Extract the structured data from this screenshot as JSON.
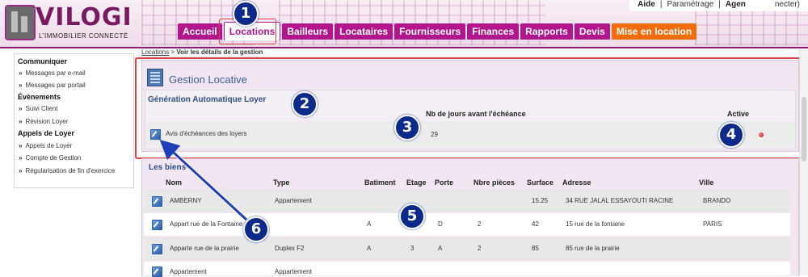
{
  "header": {
    "logo_text": "VILOGI",
    "logo_sub": "L'IMMOBILIER CONNECTÉ",
    "top_links": [
      "Aide",
      "Paramétrage",
      "Agen",
      "necter)"
    ],
    "nav": [
      {
        "label": "Accueil",
        "active": false
      },
      {
        "label": "Locations",
        "active": true
      },
      {
        "label": "Bailleurs",
        "active": false
      },
      {
        "label": "Locataires",
        "active": false
      },
      {
        "label": "Fournisseurs",
        "active": false
      },
      {
        "label": "Finances",
        "active": false
      },
      {
        "label": "Rapports",
        "active": false
      },
      {
        "label": "Devis",
        "active": false
      },
      {
        "label": "Mise en location",
        "active": false
      }
    ]
  },
  "breadcrumb": {
    "link": "Locations",
    "sep": " > ",
    "current": "Voir les détails de la gestion"
  },
  "sidebar": [
    {
      "type": "heading",
      "label": "Communiquer"
    },
    {
      "type": "item",
      "label": "Messages par e-mail"
    },
    {
      "type": "item",
      "label": "Messages par portail"
    },
    {
      "type": "heading",
      "label": "Évènements"
    },
    {
      "type": "item",
      "label": "Suivi Client"
    },
    {
      "type": "item",
      "label": "Révision Loyer"
    },
    {
      "type": "heading",
      "label": "Appels de Loyer"
    },
    {
      "type": "item",
      "label": "Appels de Loyer"
    },
    {
      "type": "item",
      "label": "Compte de Gestion"
    },
    {
      "type": "item",
      "label": "Régularisation de fin d'exercice"
    }
  ],
  "gestion": {
    "title": "Gestion Locative",
    "section_title": "Génération Automatique Loyer",
    "columns": {
      "days": "Nb de jours avant l'échéance",
      "active": "Active"
    },
    "row": {
      "label": "Avis d'échéances des loyers",
      "days": "29",
      "active": true
    }
  },
  "biens": {
    "title": "Les biens",
    "columns": [
      "Nom",
      "Type",
      "Batiment",
      "Etage",
      "Porte",
      "Nbre pièces",
      "Surface",
      "Adresse",
      "Ville"
    ],
    "rows": [
      {
        "nom": "AMBERNY",
        "type": "Appartement",
        "batiment": "",
        "etage": "",
        "porte": "",
        "pieces": "",
        "surface": "15.25",
        "adresse": "34 RUE JALAL ESSAYOUTI RACINE",
        "ville": "BRANDO"
      },
      {
        "nom": "Appart rue de la Fontaine",
        "type": "",
        "batiment": "A",
        "etage": "",
        "porte": "D",
        "pieces": "2",
        "surface": "42",
        "adresse": "15 rue de la fontaine",
        "ville": "PARIS"
      },
      {
        "nom": "Apparte rue de la prairie",
        "type": "Duplex F2",
        "batiment": "A",
        "etage": "3",
        "porte": "A",
        "pieces": "2",
        "surface": "85",
        "adresse": "85 rue de la prairie",
        "ville": ""
      },
      {
        "nom": "Appartement",
        "type": "Appartement",
        "batiment": "",
        "etage": "",
        "porte": "",
        "pieces": "",
        "surface": "",
        "adresse": "",
        "ville": ""
      }
    ]
  },
  "callouts": [
    "1",
    "2",
    "3",
    "4",
    "5",
    "6"
  ],
  "colors": {
    "brand": "#b1168c",
    "accent_orange": "#f36b0b",
    "badge": "#0b2a8a",
    "highlight_box": "#e04040"
  }
}
